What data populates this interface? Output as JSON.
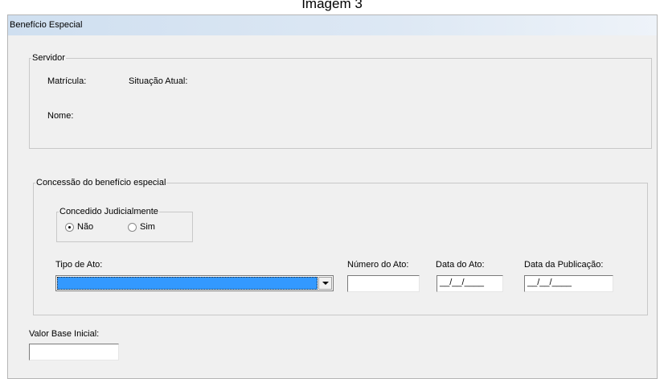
{
  "caption": "Imagem 3",
  "window": {
    "title": "Benefício Especial"
  },
  "servidor": {
    "legend": "Servidor",
    "matricula_label": "Matrícula:",
    "situacao_label": "Situação Atual:",
    "nome_label": "Nome:"
  },
  "concessao": {
    "legend": "Concessão do benefício especial",
    "judicial": {
      "legend": "Concedido Judicialmente",
      "options": [
        {
          "label": "Não",
          "checked": true
        },
        {
          "label": "Sim",
          "checked": false
        }
      ]
    },
    "tipo_ato_label": "Tipo de Ato:",
    "tipo_ato_value": "",
    "numero_ato_label": "Número do Ato:",
    "numero_ato_value": "",
    "data_ato_label": "Data do Ato:",
    "data_ato_value": "__/__/____",
    "data_publicacao_label": "Data da Publicação:",
    "data_publicacao_value": "__/__/____"
  },
  "valor_base": {
    "label": "Valor Base Inicial:",
    "value": ""
  }
}
